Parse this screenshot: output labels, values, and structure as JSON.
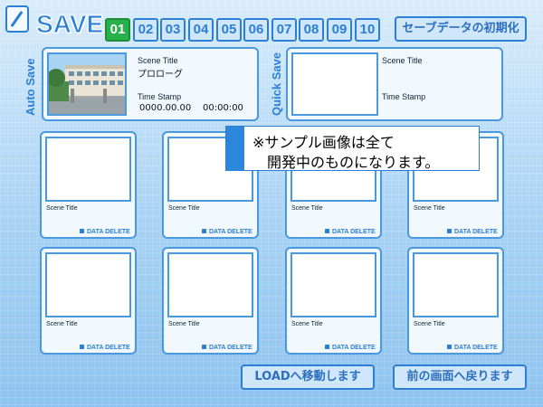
{
  "header": {
    "title": "SAVE",
    "pages": [
      "01",
      "02",
      "03",
      "04",
      "05",
      "06",
      "07",
      "08",
      "09",
      "10"
    ],
    "active_page": "01",
    "init_button": "セーブデータの初期化"
  },
  "auto_save": {
    "side_label": "Auto Save",
    "scene_title_label": "Scene Title",
    "scene_title": "プロローグ",
    "time_stamp_label": "Time Stamp",
    "date": "0000.00.00",
    "time": "00:00:00"
  },
  "quick_save": {
    "side_label": "Quick Save",
    "scene_title_label": "Scene Title",
    "time_stamp_label": "Time Stamp"
  },
  "slots": [
    {
      "scene_title_label": "Scene Title",
      "delete_label": "DATA DELETE"
    },
    {
      "scene_title_label": "Scene Title",
      "delete_label": "DATA DELETE"
    },
    {
      "scene_title_label": "Scene Title",
      "delete_label": "DATA DELETE"
    },
    {
      "scene_title_label": "Scene Title",
      "delete_label": "DATA DELETE"
    },
    {
      "scene_title_label": "Scene Title",
      "delete_label": "DATA DELETE"
    },
    {
      "scene_title_label": "Scene Title",
      "delete_label": "DATA DELETE"
    },
    {
      "scene_title_label": "Scene Title",
      "delete_label": "DATA DELETE"
    },
    {
      "scene_title_label": "Scene Title",
      "delete_label": "DATA DELETE"
    }
  ],
  "notice": {
    "line1": "※サンプル画像は全て",
    "line2": "開発中のものになります。"
  },
  "footer": {
    "load_button": "LOADへ移動します",
    "back_button": "前の画面へ戻ります"
  },
  "colors": {
    "accent": "#2b7fd6",
    "active_page": "#28b04a",
    "background": "#a9d2f3"
  },
  "icons": {
    "top_left": "pen-icon",
    "delete": "square-bullet-icon"
  }
}
